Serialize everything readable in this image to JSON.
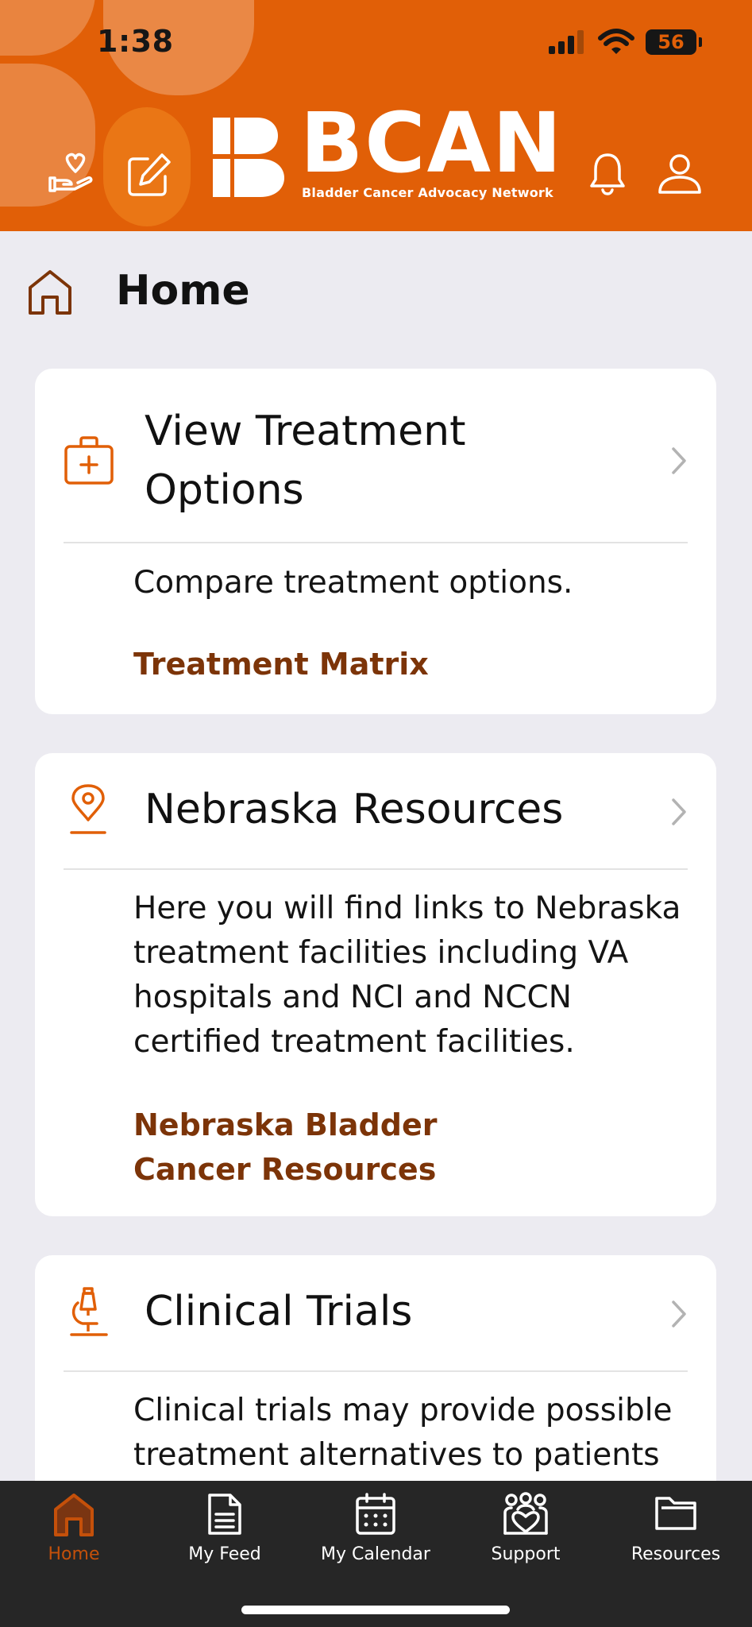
{
  "status_bar": {
    "time": "1:38",
    "battery": "56"
  },
  "header": {
    "logo_text": "BCAN",
    "logo_subtitle": "Bladder Cancer Advocacy Network",
    "icons": [
      "donate-heart-hand-icon",
      "edit-note-icon",
      "bell-icon",
      "user-icon"
    ]
  },
  "page": {
    "title": "Home",
    "icon": "home-icon"
  },
  "cards": [
    {
      "icon": "medical-kit-icon",
      "title_line1": "View Treatment",
      "title_line2": "Options",
      "description": "Compare treatment options.",
      "link": "Treatment Matrix"
    },
    {
      "icon": "map-pin-icon",
      "title": "Nebraska Resources",
      "description_lines": [
        "Here you will find links to Nebraska",
        "treatment facilities including VA",
        "hospitals and NCI and NCCN",
        "certified treatment facilities."
      ],
      "link_lines": [
        "Nebraska Bladder",
        "Cancer Resources"
      ]
    },
    {
      "icon": "microscope-icon",
      "title": "Clinical Trials",
      "description_lines": [
        "Clinical trials may provide possible",
        "treatment alternatives to patients"
      ]
    }
  ],
  "tabs": [
    {
      "label": "Home",
      "icon": "home-icon",
      "active": true
    },
    {
      "label": "My Feed",
      "icon": "document-icon",
      "active": false
    },
    {
      "label": "My Calendar",
      "icon": "calendar-icon",
      "active": false
    },
    {
      "label": "Support",
      "icon": "support-group-icon",
      "active": false
    },
    {
      "label": "Resources",
      "icon": "folder-icon",
      "active": false
    }
  ],
  "colors": {
    "brand_orange": "#e15f07",
    "link_brown": "#7c3408",
    "background": "#ecebf1",
    "tabbar": "#262626",
    "tab_active": "#c4500a"
  }
}
